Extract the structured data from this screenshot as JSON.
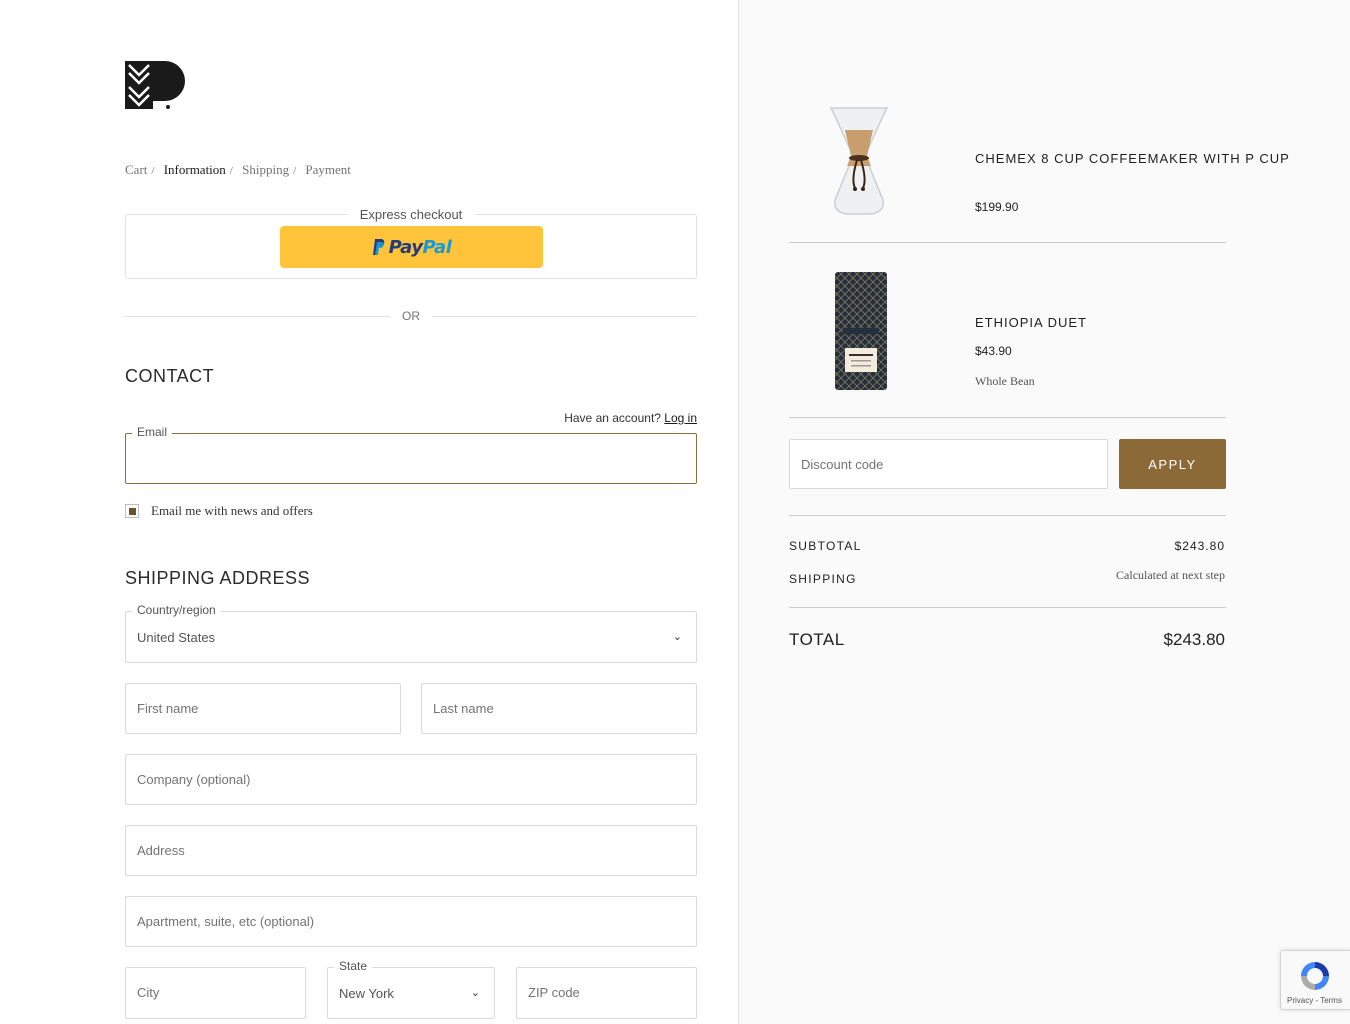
{
  "breadcrumb": [
    {
      "label": "Cart",
      "active": false
    },
    {
      "label": "Information",
      "active": true
    },
    {
      "label": "Shipping",
      "active": false
    },
    {
      "label": "Payment",
      "active": false
    }
  ],
  "express": {
    "label": "Express checkout",
    "paypal_a": "Pay",
    "paypal_b": "Pal"
  },
  "or_label": "OR",
  "contact": {
    "title": "CONTACT",
    "account_prompt": "Have an account?",
    "login_label": "Log in",
    "email_label": "Email",
    "email_value": "",
    "newsletter_label": "Email me with news and offers",
    "newsletter_checked": true
  },
  "shipping": {
    "title": "SHIPPING ADDRESS",
    "country_label": "Country/region",
    "country_value": "United States",
    "first_name_ph": "First name",
    "last_name_ph": "Last name",
    "company_ph": "Company (optional)",
    "address_ph": "Address",
    "apartment_ph": "Apartment, suite, etc (optional)",
    "city_ph": "City",
    "state_label": "State",
    "state_value": "New York",
    "zip_ph": "ZIP code"
  },
  "cart": {
    "items": [
      {
        "name": "CHEMEX 8 CUP COFFEEMAKER WITH P CUP",
        "price": "$199.90",
        "variant": ""
      },
      {
        "name": "ETHIOPIA DUET",
        "price": "$43.90",
        "variant": "Whole Bean"
      }
    ],
    "discount_ph": "Discount code",
    "apply_label": "APPLY",
    "subtotal_label": "SUBTOTAL",
    "subtotal_value": "$243.80",
    "shipping_label": "SHIPPING",
    "shipping_value": "Calculated at next step",
    "total_label": "TOTAL",
    "total_value": "$243.80"
  },
  "recaptcha": {
    "terms": "Privacy - Terms"
  },
  "colors": {
    "accent": "#8b6a37",
    "paypal_yellow": "#ffc439",
    "checkbox_fill": "#6b5330"
  }
}
